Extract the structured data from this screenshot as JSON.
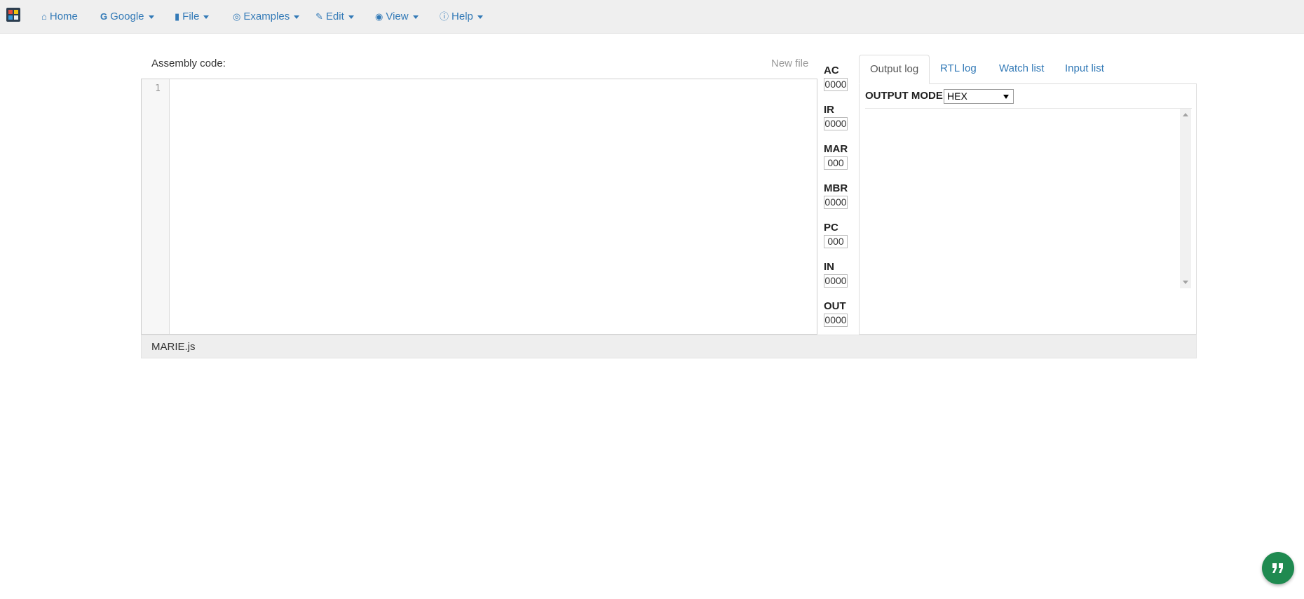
{
  "navbar": {
    "items": [
      {
        "label": "Home",
        "icon": "home-icon",
        "caret": false
      },
      {
        "label": "Google",
        "icon": "google-icon",
        "caret": true
      },
      {
        "label": "File",
        "icon": "file-icon",
        "caret": true
      },
      {
        "label": "Examples",
        "icon": "lightbulb-icon",
        "caret": true
      },
      {
        "label": "Edit",
        "icon": "pencil-icon",
        "caret": true
      },
      {
        "label": "View",
        "icon": "eye-icon",
        "caret": true
      },
      {
        "label": "Help",
        "icon": "question-circle-icon",
        "caret": true
      }
    ]
  },
  "editor": {
    "label": "Assembly code:",
    "new_file": "New file",
    "line_numbers": [
      "1"
    ]
  },
  "registers": [
    {
      "name": "AC",
      "value": "0000"
    },
    {
      "name": "IR",
      "value": "0000"
    },
    {
      "name": "MAR",
      "value": "000"
    },
    {
      "name": "MBR",
      "value": "0000"
    },
    {
      "name": "PC",
      "value": "000"
    },
    {
      "name": "IN",
      "value": "0000"
    },
    {
      "name": "OUT",
      "value": "0000"
    }
  ],
  "tabs": [
    {
      "label": "Output log",
      "active": true
    },
    {
      "label": "RTL log",
      "active": false
    },
    {
      "label": "Watch list",
      "active": false
    },
    {
      "label": "Input list",
      "active": false
    }
  ],
  "output": {
    "mode_label": "OUTPUT MODE:",
    "mode_value": "HEX"
  },
  "footer": {
    "text": "MARIE.js"
  },
  "colors": {
    "link": "#337ab7",
    "navbar_bg": "#efefef",
    "fab": "#1f8a50"
  }
}
